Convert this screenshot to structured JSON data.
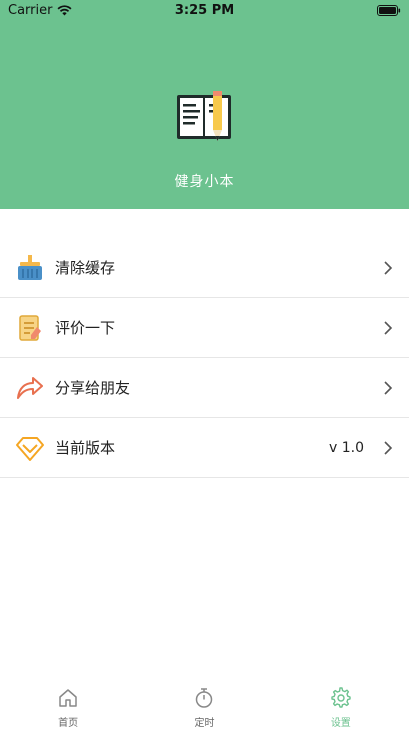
{
  "status_bar": {
    "carrier": "Carrier",
    "time": "3:25 PM"
  },
  "header": {
    "app_name": "健身小本",
    "background_color": "#6cc28f"
  },
  "menu": {
    "items": [
      {
        "label": "清除缓存",
        "icon": "basket-icon"
      },
      {
        "label": "评价一下",
        "icon": "note-icon"
      },
      {
        "label": "分享给朋友",
        "icon": "share-icon"
      },
      {
        "label": "当前版本",
        "icon": "diamond-icon",
        "value": "v 1.0"
      }
    ]
  },
  "tabbar": {
    "tabs": [
      {
        "label": "首页",
        "icon": "home-icon",
        "active": false
      },
      {
        "label": "定时",
        "icon": "timer-icon",
        "active": false
      },
      {
        "label": "设置",
        "icon": "gear-icon",
        "active": true
      }
    ],
    "active_color": "#6cc28f"
  }
}
